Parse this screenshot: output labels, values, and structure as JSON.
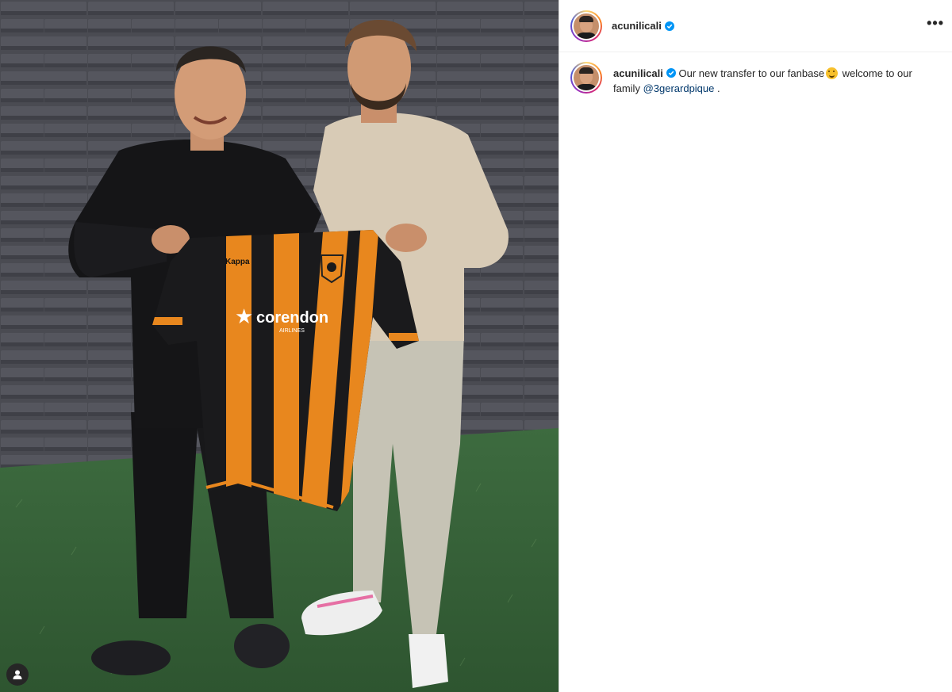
{
  "colors": {
    "accent": "#0095f6",
    "mention": "#00376b",
    "text": "#262626"
  },
  "icons": {
    "verified": "verified-badge-icon",
    "more": "more-options-icon",
    "tagged": "tagged-user-icon"
  },
  "post": {
    "header": {
      "username": "acunilicali",
      "more_label": "•••"
    },
    "caption": {
      "username": "acunilicali",
      "text_part1": "Our new transfer to our fanbase",
      "text_part2": " welcome to our family ",
      "mention": "@3gerardpique",
      "text_end": " ."
    },
    "media": {
      "shirt_sponsor_main": "corendon",
      "shirt_sponsor_sub": "AIRLINES",
      "shirt_brand": "Kappa"
    }
  }
}
